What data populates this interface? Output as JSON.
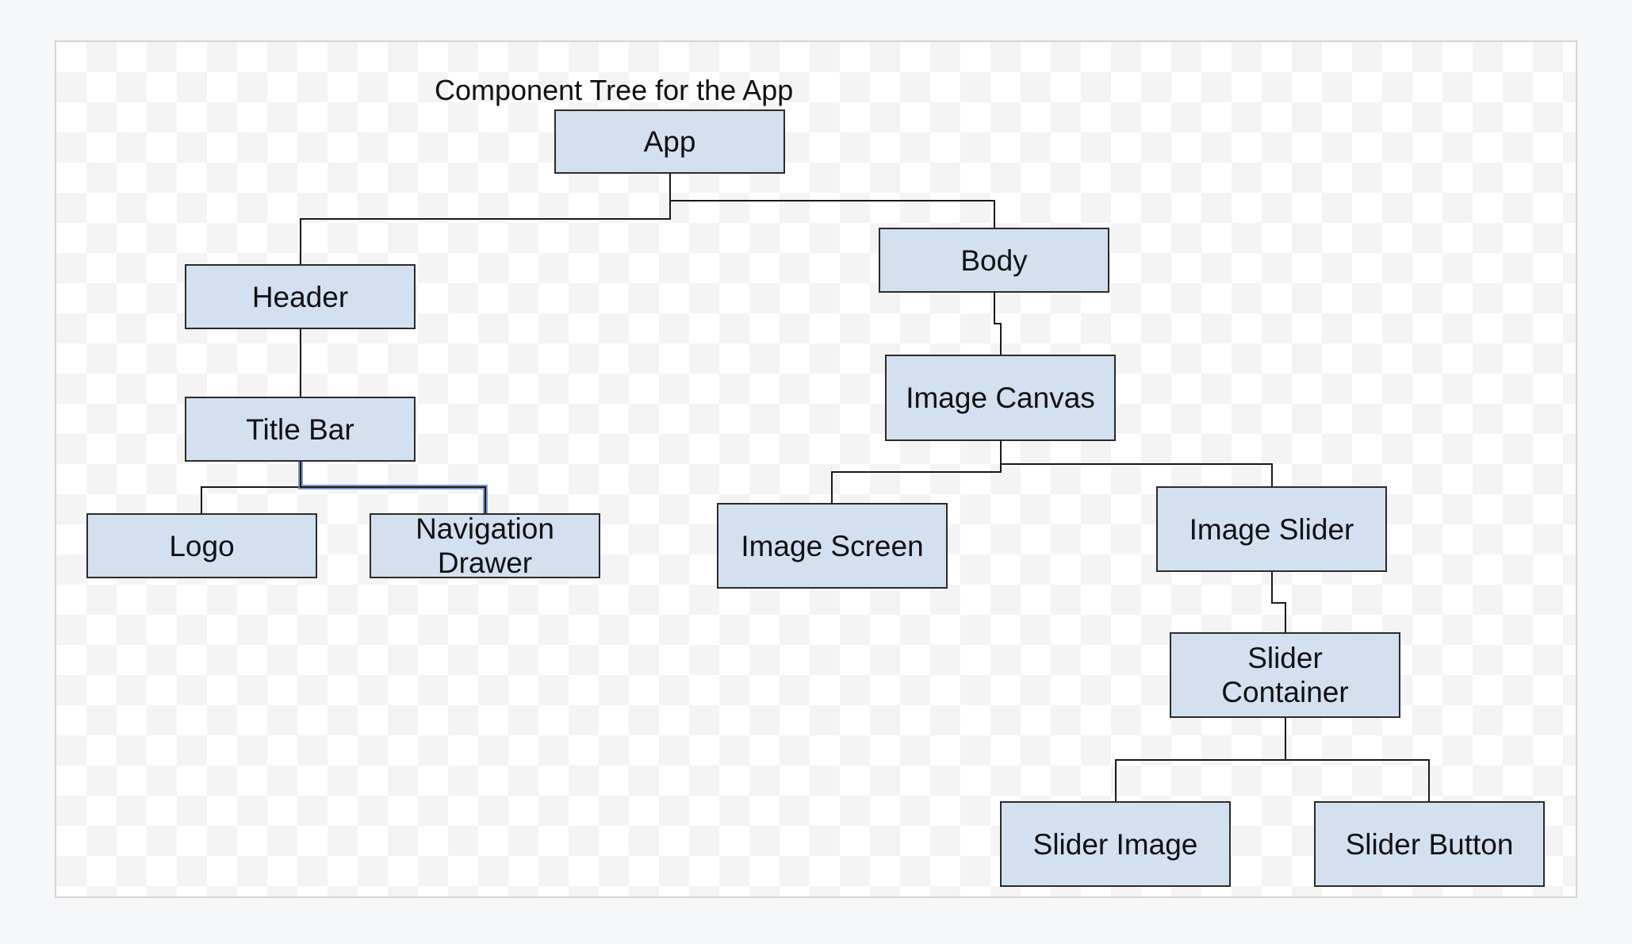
{
  "diagram": {
    "title": "Component Tree for the App",
    "colors": {
      "node_fill": "#d3e0f0",
      "node_border": "#2b2b2b",
      "connector": "#1a1a1a",
      "selected_connector": "#6a86c8"
    },
    "nodes": {
      "app": "App",
      "header": "Header",
      "body": "Body",
      "title_bar": "Title Bar",
      "logo": "Logo",
      "navigation_drawer": "Navigation\nDrawer",
      "image_canvas": "Image Canvas",
      "image_screen": "Image Screen",
      "image_slider": "Image Slider",
      "slider_container": "Slider\nContainer",
      "slider_image": "Slider Image",
      "slider_button": "Slider Button"
    }
  }
}
